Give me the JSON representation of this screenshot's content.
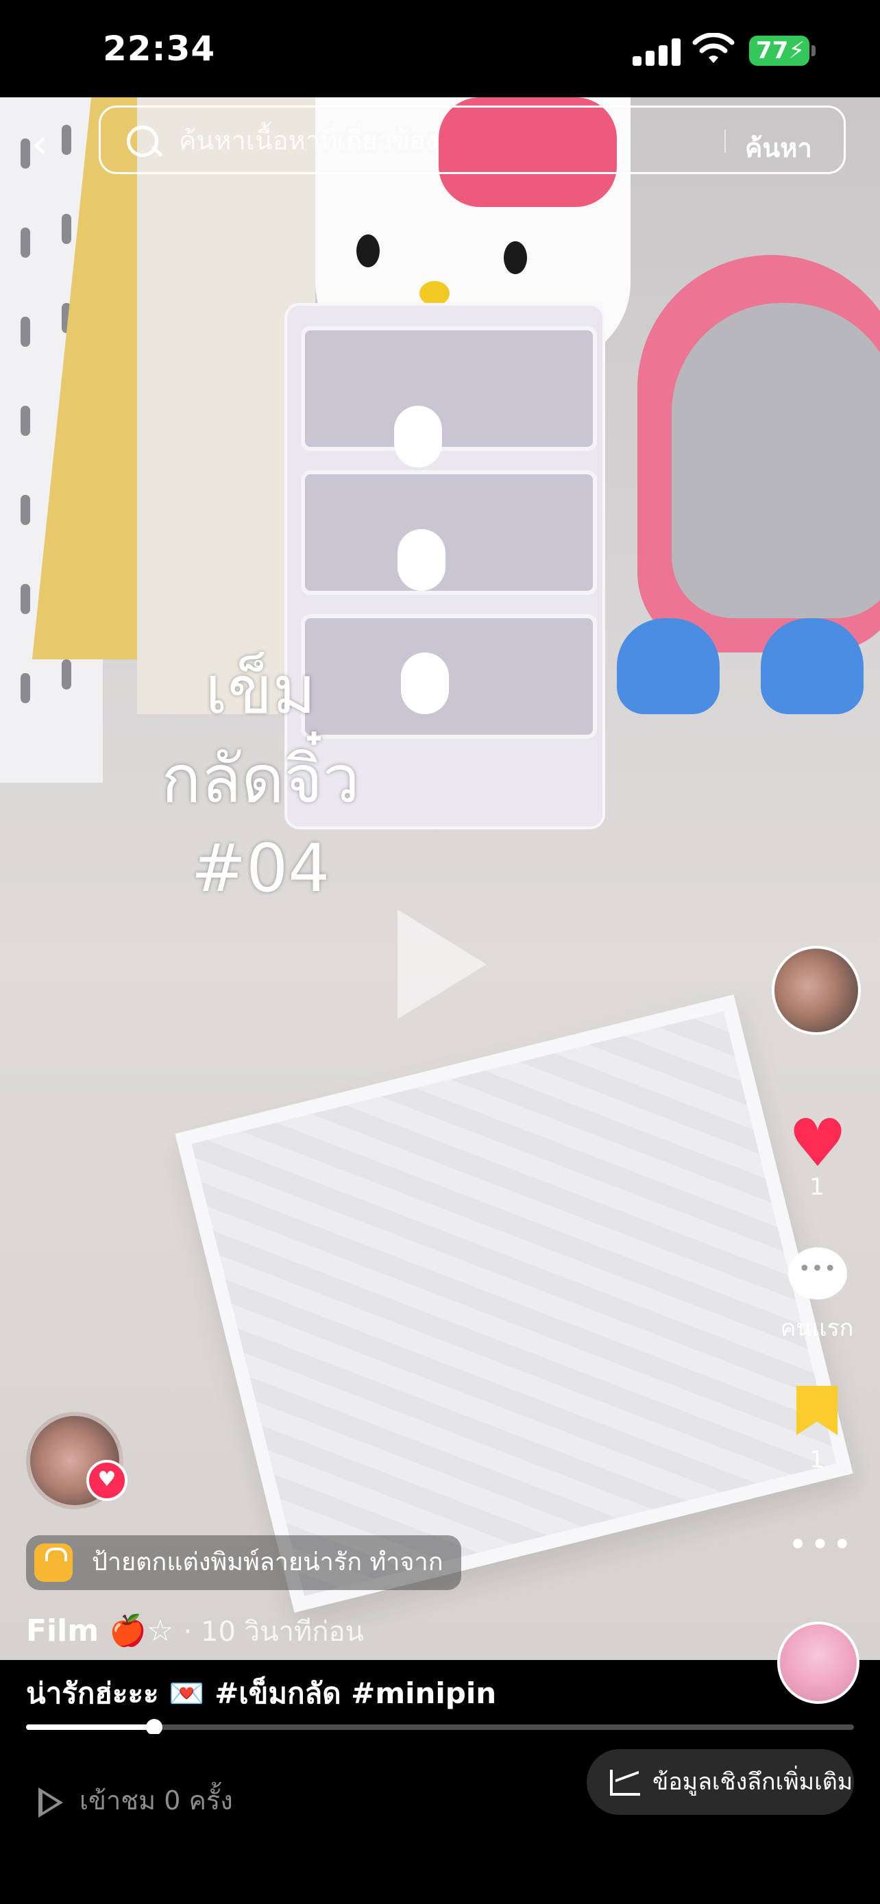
{
  "status_bar": {
    "time": "22:34",
    "battery_percent": "77",
    "icons": [
      "cellular-signal-icon",
      "wifi-icon",
      "battery-charging-icon"
    ]
  },
  "top_bar": {
    "back_icon": "chevron-left-icon",
    "search_placeholder": "ค้นหาเนื้อหาที่เกี่ยวข้อง",
    "search_button": "ค้นหา"
  },
  "video_overlay": {
    "title_lines": [
      "เข็ม",
      "กลัดจิ๋ว",
      "#04"
    ]
  },
  "right_rail": {
    "like_count": "1",
    "comment_label": "คนแรก",
    "bookmark_count": "1",
    "more_icon": "more-dots-icon"
  },
  "product_tag": {
    "label": "ป้ายตกแต่งพิมพ์ลายน่ารัก ทำจาก"
  },
  "author": {
    "name": "Film 🍎☆",
    "time": "· 10 วินาทีก่อน"
  },
  "caption": "น่ารักฮ่ะะะ 💌 #เข็มกลัด #minipin",
  "playback": {
    "progress_fraction": 0.155
  },
  "bottom_bar": {
    "views": "เข้าชม 0 ครั้ง",
    "insights_button": "ข้อมูลเชิงลึกเพิ่มเติม"
  },
  "colors": {
    "like_heart": "#fe2c55",
    "bookmark": "#facd2c",
    "battery": "#34c759"
  }
}
